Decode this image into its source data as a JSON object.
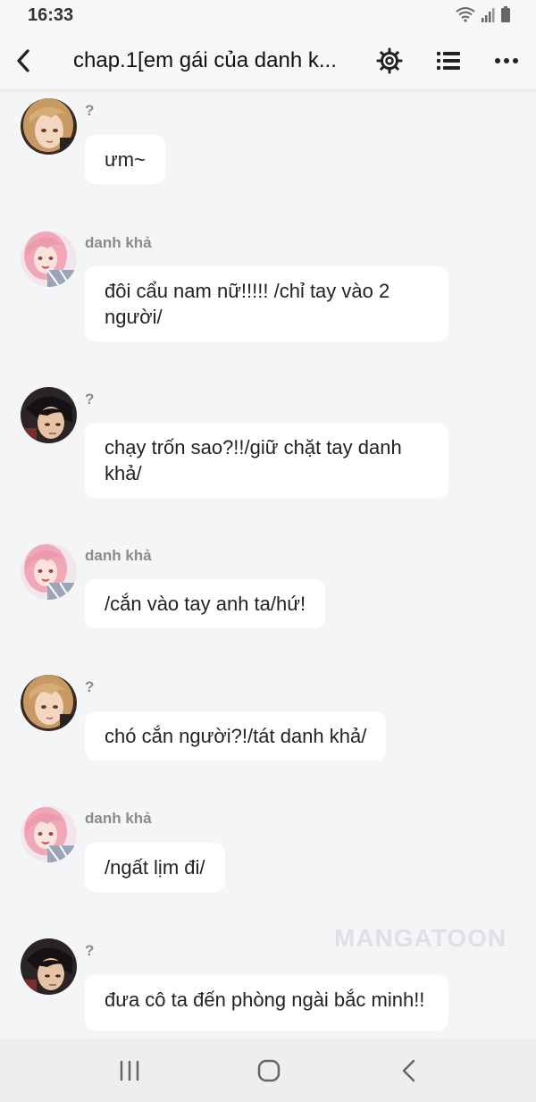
{
  "status": {
    "time": "16:33"
  },
  "header": {
    "title": "chap.1[em gái của danh k..."
  },
  "messages": [
    {
      "name": "?",
      "avatar": "blonde-girl",
      "text": "ưm~"
    },
    {
      "name": "danh khả",
      "avatar": "pink-hair-girl",
      "text": "đôi cẩu nam nữ!!!!! /chỉ tay vào 2 người/"
    },
    {
      "name": "?",
      "avatar": "dark-hair-man",
      "text": "chạy trốn sao?!!/giữ chặt tay danh khả/"
    },
    {
      "name": "danh khả",
      "avatar": "pink-hair-girl",
      "text": "/cắn vào tay anh ta/hứ!"
    },
    {
      "name": "?",
      "avatar": "blonde-girl",
      "text": "chó cắn người?!/tát danh khả/"
    },
    {
      "name": "danh khả",
      "avatar": "pink-hair-girl",
      "text": "/ngất lịm đi/"
    },
    {
      "name": "?",
      "avatar": "dark-hair-man",
      "text": "đưa cô ta đến phòng ngài bắc minh!!"
    }
  ],
  "watermark": "MANGATOON",
  "icons": {
    "back": "chevron-left-icon",
    "settings": "gear-icon",
    "list": "list-icon",
    "more": "more-dots-icon",
    "nav_recent": "recent-apps-icon",
    "nav_home": "home-icon",
    "nav_back": "back-icon"
  }
}
